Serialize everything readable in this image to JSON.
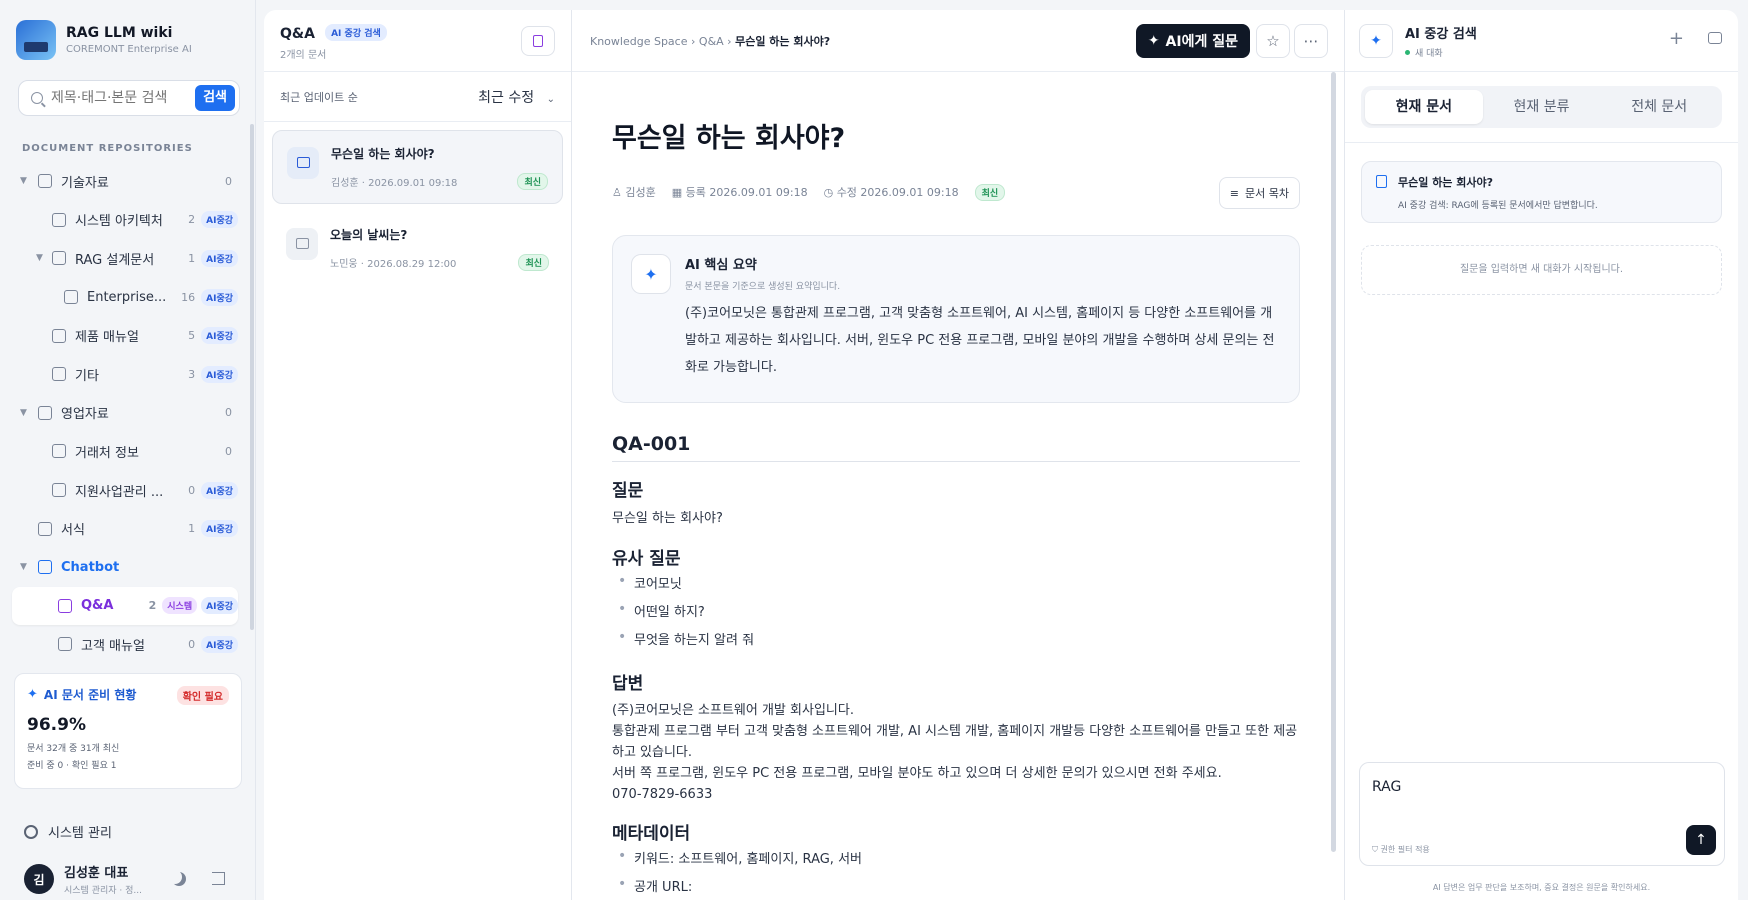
{
  "brand": {
    "title": "RAG LLM wiki",
    "subtitle": "COREMONT Enterprise AI"
  },
  "search": {
    "placeholder": "제목·태그·본문 검색",
    "button": "검색"
  },
  "sidebar": {
    "section_title": "DOCUMENT REPOSITORIES",
    "items": [
      {
        "label": "기술자료",
        "count": "0",
        "badge": ""
      },
      {
        "label": "시스템 아키텍처",
        "count": "2",
        "badge": "AI중강"
      },
      {
        "label": "RAG 설계문서",
        "count": "1",
        "badge": "AI중강"
      },
      {
        "label": "Enterprise...",
        "count": "16",
        "badge": "AI중강"
      },
      {
        "label": "제품 매뉴얼",
        "count": "5",
        "badge": "AI중강"
      },
      {
        "label": "기타",
        "count": "3",
        "badge": "AI중강"
      },
      {
        "label": "영업자료",
        "count": "0",
        "badge": ""
      },
      {
        "label": "거래처 정보",
        "count": "0",
        "badge": ""
      },
      {
        "label": "지원사업관리 ...",
        "count": "0",
        "badge": "AI중강"
      },
      {
        "label": "서식",
        "count": "1",
        "badge": "AI중강"
      },
      {
        "label": "Chatbot",
        "count": "",
        "badge": ""
      },
      {
        "label": "Q&A",
        "count": "2",
        "badge": "AI중강",
        "badge2": "시스템"
      },
      {
        "label": "고객 매뉴얼",
        "count": "0",
        "badge": "AI중강"
      }
    ],
    "ai_status": {
      "title": "AI 문서 준비 현황",
      "badge": "확인 필요",
      "percent": "96.9%",
      "line1": "문서 32개 중 31개 최신",
      "line2": "준비 중 0 · 확인 필요 1"
    },
    "system_mgmt": "시스템 관리",
    "user": {
      "avatar": "김",
      "name": "김성훈 대표",
      "role": "시스템 관리자 · 정..."
    }
  },
  "list": {
    "title": "Q&A",
    "badge": "AI 중강 검색",
    "count": "2개의 문서",
    "sort_label": "최근 업데이트 순",
    "sort_value": "최근 수정",
    "items": [
      {
        "title": "무슨일 하는 회사야?",
        "author": "김성훈",
        "date": "2026.09.01 09:18",
        "badge": "최신"
      },
      {
        "title": "오늘의 날씨는?",
        "author": "노민웅",
        "date": "2026.08.29 12:00",
        "badge": "최신"
      }
    ]
  },
  "doc": {
    "breadcrumb": [
      "Knowledge Space",
      "Q&A",
      "무슨일 하는 회사야?"
    ],
    "ask_button": "AI에게 질문",
    "title": "무슨일 하는 회사야?",
    "author": "김성훈",
    "created": "등록 2026.09.01 09:18",
    "modified": "수정 2026.09.01 09:18",
    "status": "최신",
    "toc_button": "문서 목차",
    "summary": {
      "title": "AI 핵심 요약",
      "subtitle": "문서 본문을 기준으로 생성된 요약입니다.",
      "body": "(주)코어모닛은 통합관제 프로그램, 고객 맞춤형 소프트웨어, AI 시스템, 홈페이지 등 다양한 소프트웨어를 개발하고 제공하는 회사입니다. 서버, 윈도우 PC 전용 프로그램, 모바일 분야의 개발을 수행하며 상세 문의는 전화로 가능합니다."
    },
    "qa_id": "QA-001",
    "question_heading": "질문",
    "question": "무슨일 하는 회사야?",
    "similar_heading": "유사 질문",
    "similar": [
      "코어모닛",
      "어떤일 하지?",
      "무엇을 하는지 알려 줘"
    ],
    "answer_heading": "답변",
    "answer": [
      "(주)코어모닛은 소프트웨어 개발 회사입니다.",
      "통합관제 프로그램 부터 고객 맞춤형 소프트웨어 개발, AI 시스템 개발, 홈페이지 개발등 다양한 소프트웨어를 만들고 또한 제공 하고 있습니다.",
      "서버 쪽 프로그램, 윈도우 PC 전용 프로그램, 모바일 분야도 하고 있으며 더 상세한 문의가 있으시면 전화 주세요.",
      "070-7829-6633"
    ],
    "meta_heading": "메타데이터",
    "meta": [
      "키워드: 소프트웨어, 홈페이지, RAG, 서버",
      "공개 URL:"
    ]
  },
  "ai_panel": {
    "title": "AI 중강 검색",
    "subtitle": "새 대화",
    "tabs": [
      "현재 문서",
      "현재 분류",
      "전체 문서"
    ],
    "current_doc_title": "무슨일 하는 회사야?",
    "current_doc_sub": "AI 중강 검색: RAG에 등록된 문서에서만 답변합니다.",
    "empty_hint": "질문을 입력하면 새 대화가 시작됩니다.",
    "input_value": "RAG",
    "input_hint": "권한 필터 적용",
    "footer": "AI 답변은 업무 판단을 보조하며, 중요 결정은 원문을 확인하세요."
  }
}
